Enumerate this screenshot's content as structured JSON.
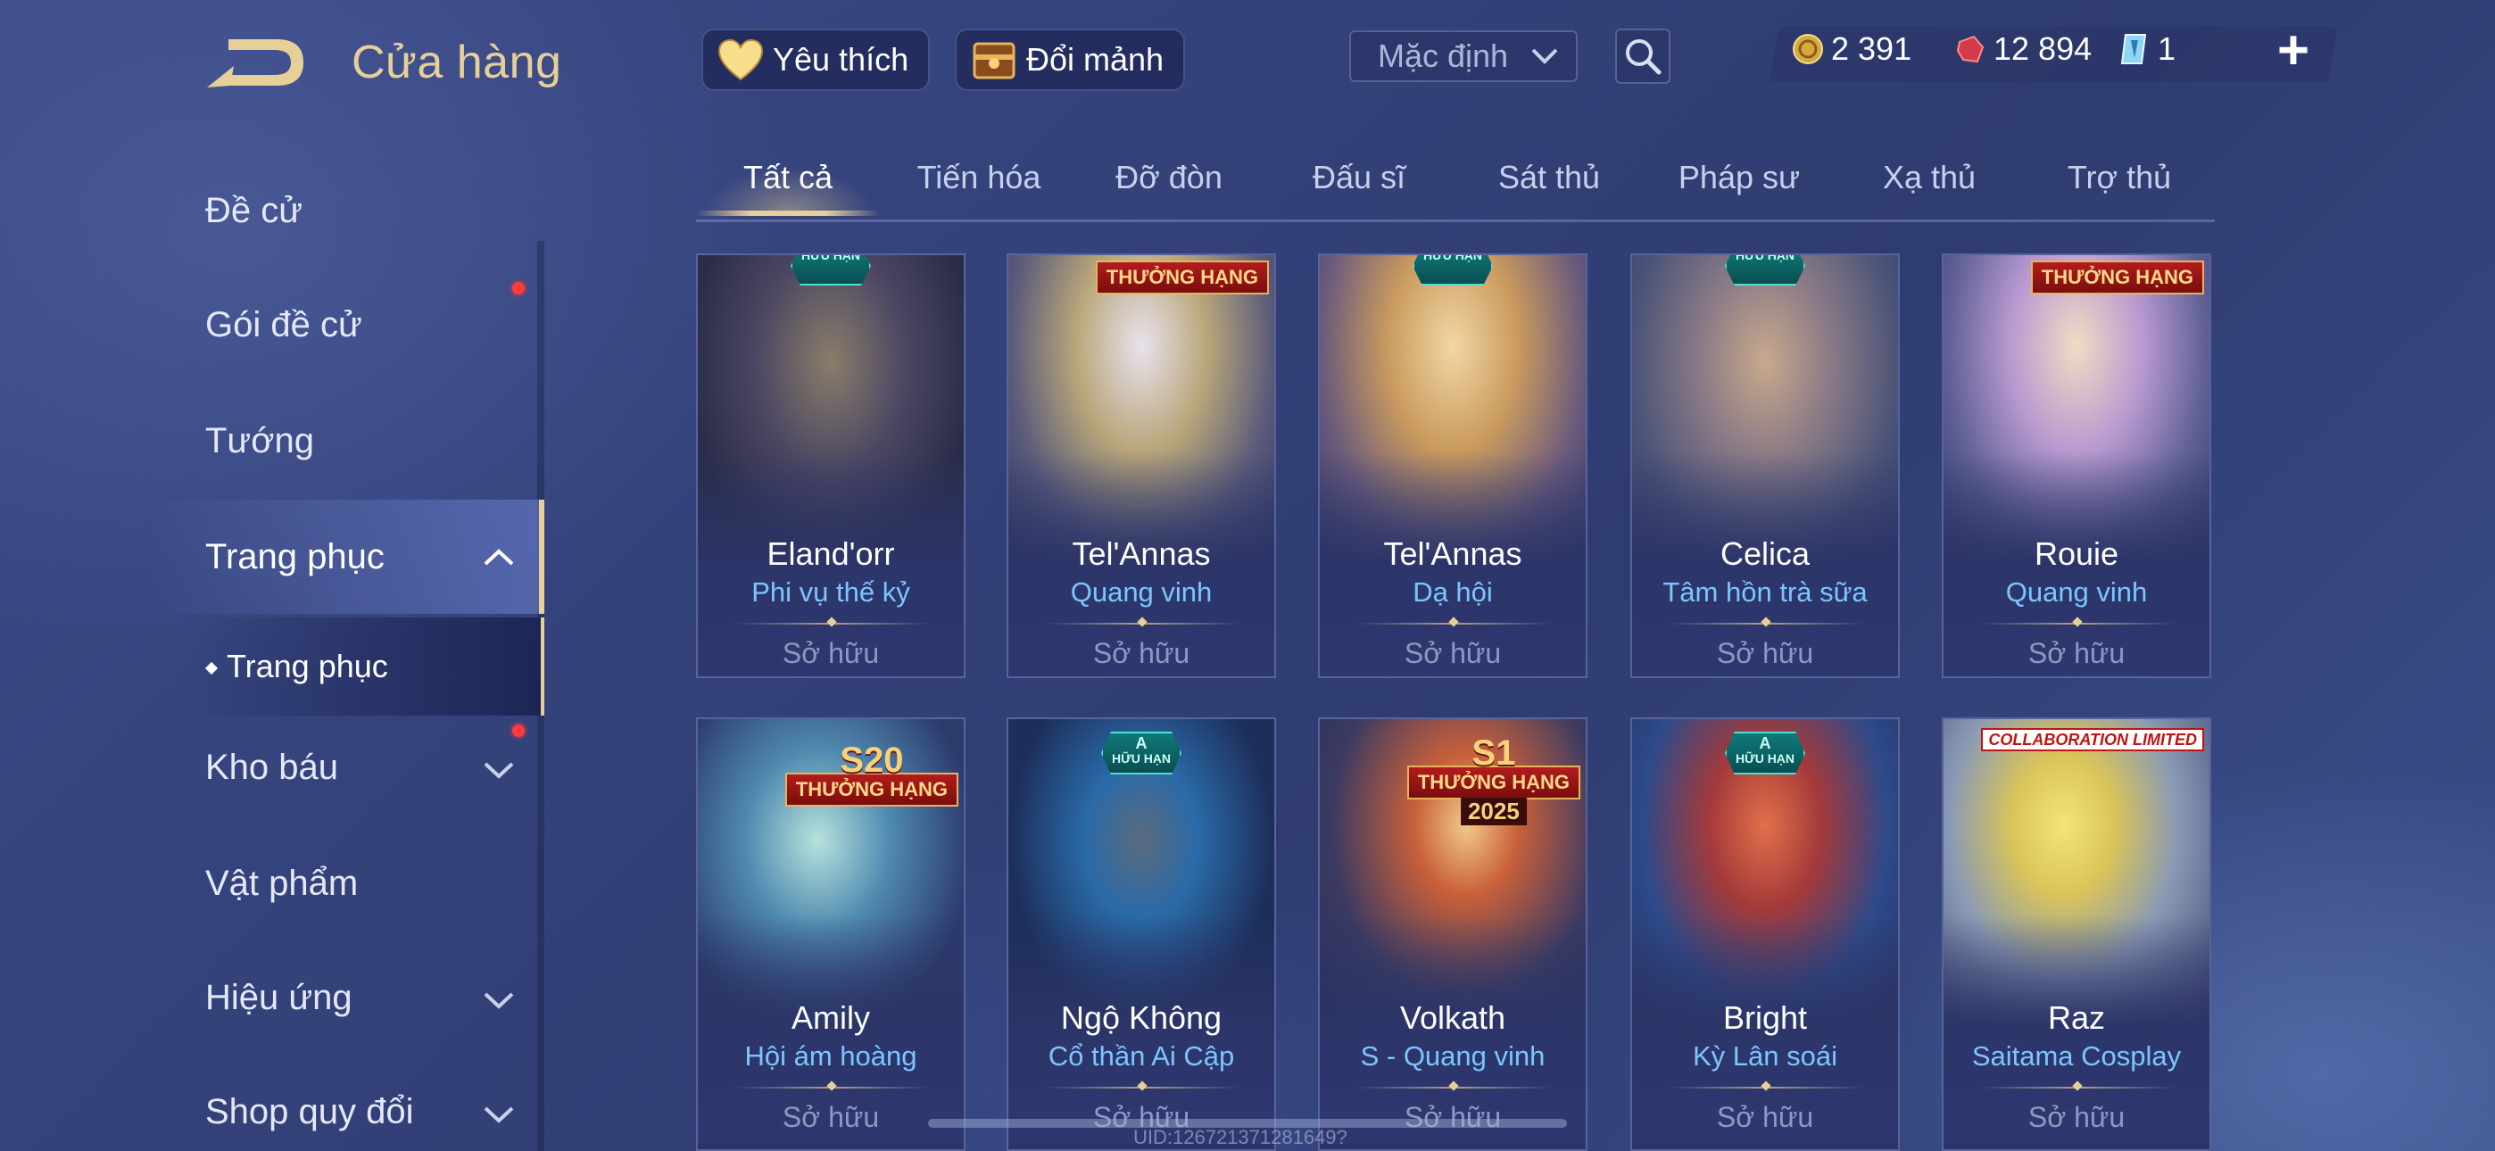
{
  "header": {
    "title": "Cửa hàng",
    "favorites_label": "Yêu thích",
    "shard_exchange_label": "Đổi mảnh",
    "sort_value": "Mặc định"
  },
  "currencies": {
    "gold": "2 391",
    "vouchers": "12 894",
    "gems": "1"
  },
  "sidebar": {
    "items": [
      {
        "label": "Đề cử"
      },
      {
        "label": "Gói đề cử"
      },
      {
        "label": "Tướng"
      },
      {
        "label": "Trang phục"
      },
      {
        "label": "Trang phục"
      },
      {
        "label": "Kho báu"
      },
      {
        "label": "Vật phẩm"
      },
      {
        "label": "Hiệu ứng"
      },
      {
        "label": "Shop quy đổi"
      }
    ]
  },
  "tabs": [
    "Tất cả",
    "Tiến hóa",
    "Đỡ đòn",
    "Đấu sĩ",
    "Sát thủ",
    "Pháp sư",
    "Xạ thủ",
    "Trợ thủ"
  ],
  "cards": [
    {
      "hero": "Eland'orr",
      "skin": "Phi vụ thế kỷ",
      "status": "Sở hữu",
      "badge": "HỮU HẠN"
    },
    {
      "hero": "Tel'Annas",
      "skin": "Quang vinh",
      "status": "Sở hữu",
      "badge": "THƯỞNG HẠNG"
    },
    {
      "hero": "Tel'Annas",
      "skin": "Dạ hội",
      "status": "Sở hữu",
      "badge": "HỮU HẠN"
    },
    {
      "hero": "Celica",
      "skin": "Tâm hồn trà sữa",
      "status": "Sở hữu",
      "badge": "HỮU HẠN"
    },
    {
      "hero": "Rouie",
      "skin": "Quang vinh",
      "status": "Sở hữu",
      "badge": "THƯỞNG HẠNG"
    },
    {
      "hero": "Amily",
      "skin": "Hội ám hoàng",
      "status": "Sở hữu",
      "badge": "THƯỞNG HẠNG",
      "badge_top": "S20"
    },
    {
      "hero": "Ngộ Không",
      "skin": "Cổ thần Ai Cập",
      "status": "Sở hữu",
      "badge": "HỮU HẠN",
      "badge_top": "A"
    },
    {
      "hero": "Volkath",
      "skin": "S - Quang vinh",
      "status": "Sở hữu",
      "badge": "THƯỞNG HẠNG",
      "badge_top": "S1",
      "badge_year": "2025"
    },
    {
      "hero": "Bright",
      "skin": "Kỳ Lân soái",
      "status": "Sở hữu",
      "badge": "HỮU HẠN",
      "badge_top": "A"
    },
    {
      "hero": "Raz",
      "skin": "Saitama Cosplay",
      "status": "Sở hữu",
      "badge": "COLLABORATION LIMITED"
    }
  ],
  "footer": {
    "uid": "UID:126721371281649?"
  },
  "colors": {
    "gold_accent": "#e7cf98",
    "skin_name": "#7cc5ff",
    "owned_text": "#8f98c0",
    "notification_dot": "#ff3b3b"
  },
  "icons": {
    "back": "back-arrow-icon",
    "favorite": "heart-icon",
    "shard": "chest-icon",
    "sort": "chevron-down-icon",
    "search": "search-icon",
    "gold": "gold-coin-icon",
    "voucher": "voucher-icon",
    "gem": "gem-icon",
    "add": "plus-icon"
  }
}
